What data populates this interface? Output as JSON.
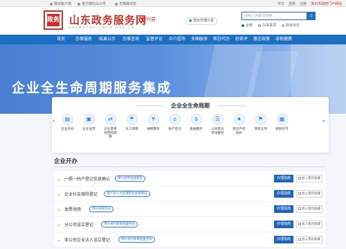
{
  "utilbar": {
    "mobile": "移动客户端",
    "wechat": "官方微信公众号",
    "weibo": "无障碍浏览",
    "right": [
      "中文",
      "登录",
      "注册"
    ],
    "portal_link": "滨州市政府门户网站"
  },
  "header": {
    "logo_text": "政务",
    "title": "山东政务服务网",
    "subtitle": "SHANDONG  ZWFW  GOV  CN",
    "region": "博兴县",
    "location": "滨州市博兴县",
    "search_placeholder": "请输入关键词搜索",
    "search_icon": "search-icon",
    "radios": [
      {
        "label": "全部",
        "selected": true
      },
      {
        "label": "办事事项",
        "selected": false
      },
      {
        "label": "政务资讯",
        "selected": false
      }
    ]
  },
  "nav": {
    "items": [
      "首页",
      "办事服务",
      "结果公示",
      "办事咨询",
      "监督评议",
      "中介超市",
      "多图联审",
      "帮办代办",
      "好差评",
      "惠企政策",
      "非税缴费"
    ]
  },
  "hero": {
    "title": "企业全生命周期服务集成"
  },
  "lifecycle": {
    "title": "企业全生命周期",
    "prev": "‹",
    "next": "›",
    "stages": [
      {
        "label": "企业开办",
        "icon": "document-icon"
      },
      {
        "label": "企业准营",
        "icon": "certificate-icon"
      },
      {
        "label": "企业变更\n经营和转\n换",
        "icon": "change-icon"
      },
      {
        "label": "员工保障",
        "icon": "umbrella-icon"
      },
      {
        "label": "纳税服务",
        "icon": "tax-icon"
      },
      {
        "label": "财产登记",
        "icon": "property-icon"
      },
      {
        "label": "金融服务",
        "icon": "finance-icon"
      },
      {
        "label": "公共就业\n专项服务",
        "icon": "employment-icon"
      },
      {
        "label": "知识产权\n保护",
        "icon": "ip-icon"
      },
      {
        "label": "项目立项",
        "icon": "project-icon"
      },
      {
        "label": "规划许可",
        "icon": "permit-icon"
      }
    ]
  },
  "section": {
    "title": "企业开办"
  },
  "items": [
    {
      "name": "一照一码户登记信息确认",
      "tag": "博兴县市场监管局",
      "apply": "办理指南",
      "fav": "加入我的收藏"
    },
    {
      "name": "企业社会保险登记",
      "tag": "博兴县人力资源和社会保障局",
      "apply": "办理指南",
      "fav": "加入我的收藏"
    },
    {
      "name": "发票领用",
      "tag": "博兴县税务局",
      "apply": "办理指南",
      "fav": "加入我的收藏"
    },
    {
      "name": "分公司设立登记",
      "tag": "博兴县行政审批服务局",
      "apply": "办理指南",
      "fav": "加入我的收藏"
    },
    {
      "name": "非公司企业法人设立登记",
      "tag": "博兴县行政审批服务局",
      "apply": "办理指南",
      "fav": "加入我的收藏"
    }
  ],
  "colors": {
    "brand_red": "#c8312a",
    "nav_blue": "#1a6fc0",
    "button_blue": "#1f64b8"
  }
}
